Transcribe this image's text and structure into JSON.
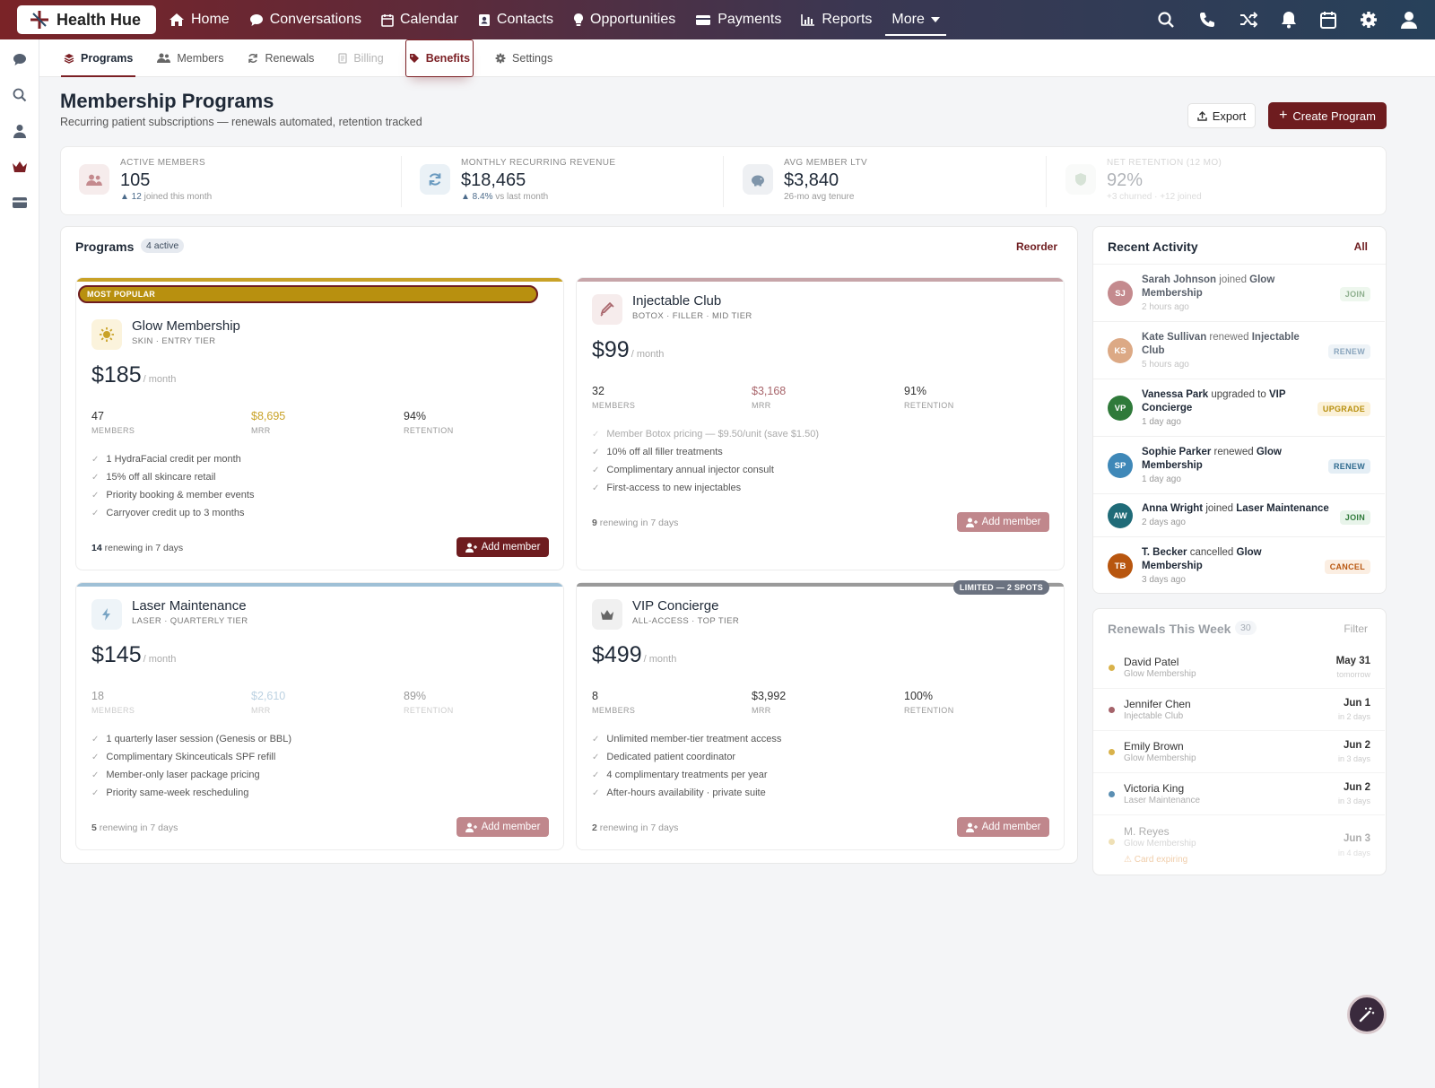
{
  "nav": {
    "brand": "Health Hue",
    "items": [
      {
        "label": "Home",
        "icon": "home-icon"
      },
      {
        "label": "Conversations",
        "icon": "chat-icon"
      },
      {
        "label": "Calendar",
        "icon": "calendar-icon"
      },
      {
        "label": "Contacts",
        "icon": "contacts-icon"
      },
      {
        "label": "Opportunities",
        "icon": "lightbulb-icon"
      },
      {
        "label": "Payments",
        "icon": "card-icon"
      },
      {
        "label": "Reports",
        "icon": "chart-icon"
      },
      {
        "label": "More",
        "icon": "chevron-down-icon"
      }
    ]
  },
  "subnav": {
    "tabs": [
      {
        "label": "Programs"
      },
      {
        "label": "Members"
      },
      {
        "label": "Renewals"
      },
      {
        "label": "Billing"
      },
      {
        "label": "Benefits"
      },
      {
        "label": "Settings"
      }
    ]
  },
  "header": {
    "title": "Membership Programs",
    "subtitle": "Recurring patient subscriptions — renewals automated, retention tracked",
    "export_label": "Export",
    "create_label": "Create Program"
  },
  "stats": [
    {
      "label": "ACTIVE MEMBERS",
      "value": "105",
      "sub_strong": "▲ 12",
      "sub": " joined this month"
    },
    {
      "label": "MONTHLY RECURRING REVENUE",
      "value": "$18,465",
      "sub_strong": "▲ 8.4%",
      "sub": " vs last month"
    },
    {
      "label": "AVG MEMBER LTV",
      "value": "$3,840",
      "sub_strong": "",
      "sub": "26-mo avg tenure"
    },
    {
      "label": "NET RETENTION (12 MO)",
      "value": "92%",
      "sub_strong": "",
      "sub": "+3 churned · +12 joined"
    }
  ],
  "programs": {
    "title": "Programs",
    "count": "4 active",
    "reorder": "Reorder",
    "cards": [
      {
        "badge": "MOST POPULAR",
        "name": "Glow Membership",
        "tier": "SKIN · ENTRY TIER",
        "price": "$185",
        "per": "/ month",
        "members": "47",
        "members_label": "MEMBERS",
        "mrr": "$8,695",
        "mrr_label": "MRR",
        "retention": "94%",
        "retention_label": "RETENTION",
        "benefits": [
          "1 HydraFacial credit per month",
          "15% off all skincare retail",
          "Priority booking & member events",
          "Carryover credit up to 3 months"
        ],
        "renew_count": "14",
        "renew_text": " renewing in 7 days",
        "add_label": "Add member",
        "accent": "#c9a227"
      },
      {
        "badge": "",
        "name": "Injectable Club",
        "tier": "BOTOX · FILLER · MID TIER",
        "price": "$99",
        "per": "/ month",
        "members": "32",
        "members_label": "MEMBERS",
        "mrr": "$3,168",
        "mrr_label": "MRR",
        "retention": "91%",
        "retention_label": "RETENTION",
        "benefits": [
          "Member Botox pricing — $9.50/unit (save $1.50)",
          "10% off all filler treatments",
          "Complimentary annual injector consult",
          "First-access to new injectables"
        ],
        "renew_count": "9",
        "renew_text": " renewing in 7 days",
        "add_label": "Add member",
        "accent": "#b08a8f"
      },
      {
        "badge": "",
        "name": "Laser Maintenance",
        "tier": "LASER · QUARTERLY TIER",
        "price": "$145",
        "per": "/ month",
        "members": "18",
        "members_label": "MEMBERS",
        "mrr": "$2,610",
        "mrr_label": "MRR",
        "retention": "89%",
        "retention_label": "RETENTION",
        "benefits": [
          "1 quarterly laser session (Genesis or BBL)",
          "Complimentary Skinceuticals SPF refill",
          "Member-only laser package pricing",
          "Priority same-week rescheduling"
        ],
        "renew_count": "5",
        "renew_text": " renewing in 7 days",
        "add_label": "Add member",
        "accent": "#8fb3cc"
      },
      {
        "badge": "LIMITED — 2 SPOTS",
        "name": "VIP Concierge",
        "tier": "ALL-ACCESS · TOP TIER",
        "price": "$499",
        "per": "/ month",
        "members": "8",
        "members_label": "MEMBERS",
        "mrr": "$3,992",
        "mrr_label": "MRR",
        "retention": "100%",
        "retention_label": "RETENTION",
        "benefits": [
          "Unlimited member-tier treatment access",
          "Dedicated patient coordinator",
          "4 complimentary treatments per year",
          "After-hours availability · private suite"
        ],
        "renew_count": "2",
        "renew_text": " renewing in 7 days",
        "add_label": "Add member",
        "accent": "#9a9a9a"
      }
    ]
  },
  "activity": {
    "title": "Recent Activity",
    "all": "All",
    "items": [
      {
        "initials": "SJ",
        "color": "#c48a8e",
        "name": "Sarah Johnson",
        "verb": " joined ",
        "target": "Glow Membership",
        "time": "2 hours ago",
        "badge": "JOIN"
      },
      {
        "initials": "KS",
        "color": "#d6a07c",
        "name": "Kate Sullivan",
        "verb": " renewed ",
        "target": "Injectable Club",
        "time": "5 hours ago",
        "badge": "RENEW"
      },
      {
        "initials": "VP",
        "color": "#2f7a3a",
        "name": "Vanessa Park",
        "verb": " upgraded to ",
        "target": "VIP Concierge",
        "time": "1 day ago",
        "badge": "UPGRADE"
      },
      {
        "initials": "SP",
        "color": "#3f88b8",
        "name": "Sophie Parker",
        "verb": " renewed ",
        "target": "Glow Membership",
        "time": "1 day ago",
        "badge": "RENEW"
      },
      {
        "initials": "AW",
        "color": "#1f6b78",
        "name": "Anna Wright",
        "verb": " joined ",
        "target": "Laser Maintenance",
        "time": "2 days ago",
        "badge": "JOIN"
      },
      {
        "initials": "TB",
        "color": "#b8560f",
        "name": "T. Becker",
        "verb": " cancelled ",
        "target": "Glow Membership",
        "time": "3 days ago",
        "badge": "CANCEL"
      }
    ]
  },
  "renewals": {
    "title": "Renewals This Week",
    "count": "30",
    "filter": "Filter",
    "items": [
      {
        "name": "David Patel",
        "program": "Glow Membership",
        "date": "May 31",
        "rel": "tomorrow",
        "dot": "#d9b24a",
        "warn": ""
      },
      {
        "name": "Jennifer Chen",
        "program": "Injectable Club",
        "date": "Jun 1",
        "rel": "in 2 days",
        "dot": "#a5636a",
        "warn": ""
      },
      {
        "name": "Emily Brown",
        "program": "Glow Membership",
        "date": "Jun 2",
        "rel": "in 3 days",
        "dot": "#d9b24a",
        "warn": ""
      },
      {
        "name": "Victoria King",
        "program": "Laser Maintenance",
        "date": "Jun 2",
        "rel": "in 3 days",
        "dot": "#5b8fb3",
        "warn": ""
      },
      {
        "name": "M. Reyes",
        "program": "Glow Membership",
        "date": "Jun 3",
        "rel": "in 4 days",
        "dot": "#d9b24a",
        "warn": "⚠ Card expiring"
      }
    ]
  }
}
